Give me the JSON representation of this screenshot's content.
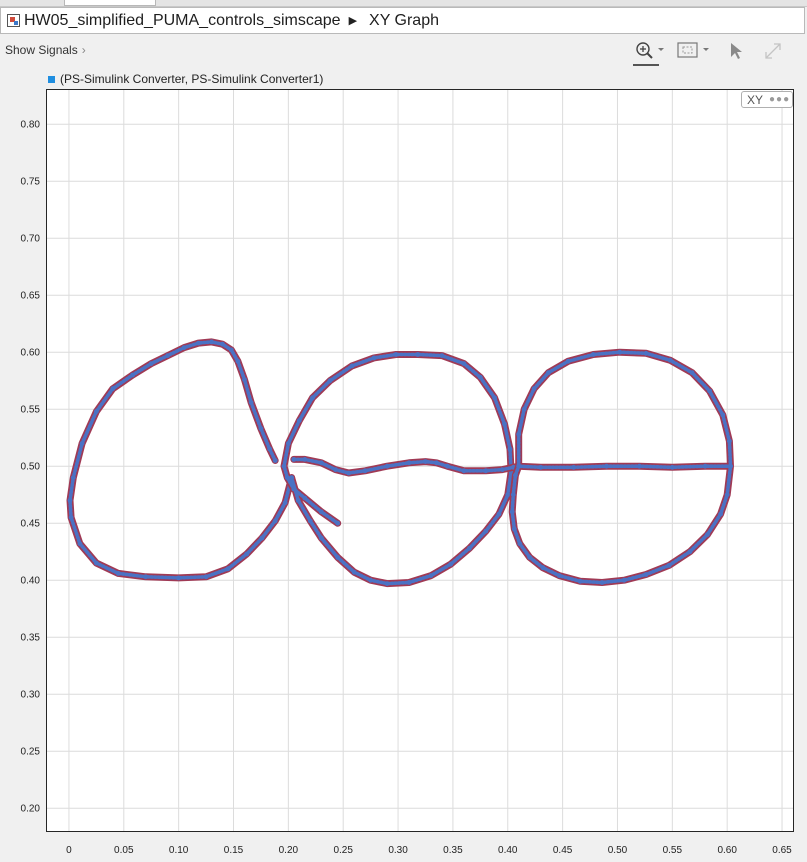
{
  "breadcrumb": {
    "model": "HW05_simplified_PUMA_controls_simscape",
    "current": "XY Graph"
  },
  "toolbar": {
    "show_signals_label": "Show Signals",
    "icons": [
      "zoom-in-icon",
      "fit-to-view-icon",
      "cursor-icon",
      "expand-icon"
    ]
  },
  "legend": {
    "label": "(PS-Simulink Converter, PS-Simulink Converter1)",
    "color": "#1f8ee0"
  },
  "badge": {
    "label": "XY"
  },
  "chart_data": {
    "type": "scatter",
    "xlim": [
      -0.02,
      0.66
    ],
    "ylim": [
      0.18,
      0.83
    ],
    "x_ticks": [
      "0",
      "0.05",
      "0.10",
      "0.15",
      "0.20",
      "0.25",
      "0.30",
      "0.35",
      "0.40",
      "0.45",
      "0.50",
      "0.55",
      "0.60",
      "0.65"
    ],
    "y_ticks": [
      "0.80",
      "0.75",
      "0.70",
      "0.65",
      "0.60",
      "0.55",
      "0.50",
      "0.45",
      "0.40",
      "0.35",
      "0.30",
      "0.25",
      "0.20"
    ],
    "grid": true,
    "line_color": "#a03a55",
    "marker_color": "#4a72c4",
    "series": [
      {
        "x": [
          0.188,
          0.183,
          0.175,
          0.166,
          0.16,
          0.154,
          0.148,
          0.14,
          0.13,
          0.118,
          0.105,
          0.09,
          0.075,
          0.058,
          0.04,
          0.025,
          0.012,
          0.004,
          0.001,
          0.002,
          0.01,
          0.025,
          0.045,
          0.07,
          0.1,
          0.125,
          0.145,
          0.162,
          0.176,
          0.188,
          0.197,
          0.203
        ],
        "y": [
          0.505,
          0.515,
          0.533,
          0.556,
          0.576,
          0.592,
          0.602,
          0.607,
          0.609,
          0.608,
          0.604,
          0.597,
          0.59,
          0.58,
          0.568,
          0.548,
          0.52,
          0.49,
          0.47,
          0.455,
          0.432,
          0.415,
          0.406,
          0.403,
          0.402,
          0.403,
          0.41,
          0.423,
          0.437,
          0.452,
          0.468,
          0.49
        ]
      },
      {
        "x": [
          0.203,
          0.209,
          0.22,
          0.23,
          0.245,
          0.26,
          0.275,
          0.29,
          0.31,
          0.33,
          0.348,
          0.365,
          0.38,
          0.392,
          0.4,
          0.403,
          0.402,
          0.397,
          0.388,
          0.375,
          0.36,
          0.34,
          0.318,
          0.298,
          0.278,
          0.258,
          0.238,
          0.222,
          0.21,
          0.2,
          0.196,
          0.199,
          0.205,
          0.215,
          0.23,
          0.245
        ],
        "y": [
          0.49,
          0.47,
          0.452,
          0.437,
          0.42,
          0.407,
          0.4,
          0.397,
          0.398,
          0.404,
          0.414,
          0.428,
          0.443,
          0.458,
          0.475,
          0.495,
          0.515,
          0.537,
          0.56,
          0.578,
          0.59,
          0.597,
          0.598,
          0.598,
          0.595,
          0.588,
          0.575,
          0.56,
          0.54,
          0.52,
          0.5,
          0.49,
          0.48,
          0.472,
          0.46,
          0.45
        ]
      },
      {
        "x": [
          0.205,
          0.215,
          0.23,
          0.243,
          0.255,
          0.27,
          0.29,
          0.31,
          0.325,
          0.335,
          0.345,
          0.36,
          0.38,
          0.395,
          0.405,
          0.41
        ],
        "y": [
          0.506,
          0.506,
          0.503,
          0.497,
          0.494,
          0.496,
          0.5,
          0.503,
          0.504,
          0.503,
          0.5,
          0.496,
          0.496,
          0.497,
          0.499,
          0.5
        ]
      },
      {
        "x": [
          0.41,
          0.407,
          0.405,
          0.404,
          0.406,
          0.411,
          0.42,
          0.432,
          0.447,
          0.466,
          0.486,
          0.506,
          0.526,
          0.547,
          0.566,
          0.582,
          0.594,
          0.6,
          0.603,
          0.602,
          0.596,
          0.584,
          0.568,
          0.548,
          0.526,
          0.502,
          0.478,
          0.455,
          0.437,
          0.424,
          0.415,
          0.41,
          0.41,
          0.43,
          0.46,
          0.49,
          0.52,
          0.55,
          0.58,
          0.603
        ],
        "y": [
          0.5,
          0.492,
          0.475,
          0.46,
          0.445,
          0.432,
          0.42,
          0.411,
          0.404,
          0.399,
          0.398,
          0.4,
          0.405,
          0.413,
          0.425,
          0.44,
          0.458,
          0.475,
          0.5,
          0.522,
          0.545,
          0.566,
          0.582,
          0.593,
          0.599,
          0.6,
          0.598,
          0.592,
          0.582,
          0.568,
          0.55,
          0.528,
          0.5,
          0.499,
          0.499,
          0.5,
          0.5,
          0.499,
          0.5,
          0.5
        ]
      }
    ]
  }
}
